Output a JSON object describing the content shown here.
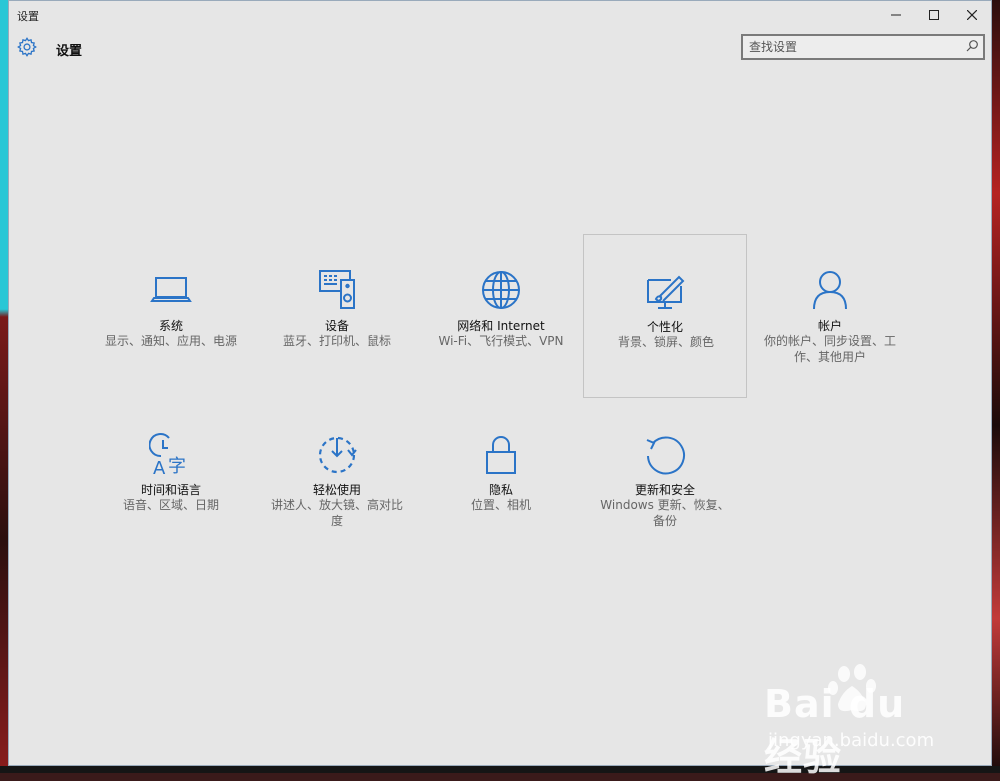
{
  "window": {
    "title": "设置"
  },
  "header": {
    "title": "设置",
    "icon": "gear-icon"
  },
  "search": {
    "placeholder": "查找设置",
    "value": ""
  },
  "accent": "#2b74c7",
  "tiles": [
    {
      "name": "系统",
      "desc": "显示、通知、应用、电源",
      "icon": "laptop-icon"
    },
    {
      "name": "设备",
      "desc": "蓝牙、打印机、鼠标",
      "icon": "devices-icon"
    },
    {
      "name": "网络和 Internet",
      "desc": "Wi-Fi、飞行模式、VPN",
      "icon": "globe-icon"
    },
    {
      "name": "个性化",
      "desc": "背景、锁屏、颜色",
      "icon": "personalization-icon",
      "selected": true
    },
    {
      "name": "帐户",
      "desc": "你的帐户、同步设置、工作、其他用户",
      "icon": "user-icon"
    },
    {
      "name": "时间和语言",
      "desc": "语音、区域、日期",
      "icon": "time-language-icon"
    },
    {
      "name": "轻松使用",
      "desc": "讲述人、放大镜、高对比度",
      "icon": "ease-of-access-icon"
    },
    {
      "name": "隐私",
      "desc": "位置、相机",
      "icon": "lock-icon"
    },
    {
      "name": "更新和安全",
      "desc": "Windows 更新、恢复、备份",
      "icon": "update-icon"
    }
  ],
  "watermark": {
    "brand": "Bai du 经验",
    "url": "jingyan.baidu.com"
  }
}
